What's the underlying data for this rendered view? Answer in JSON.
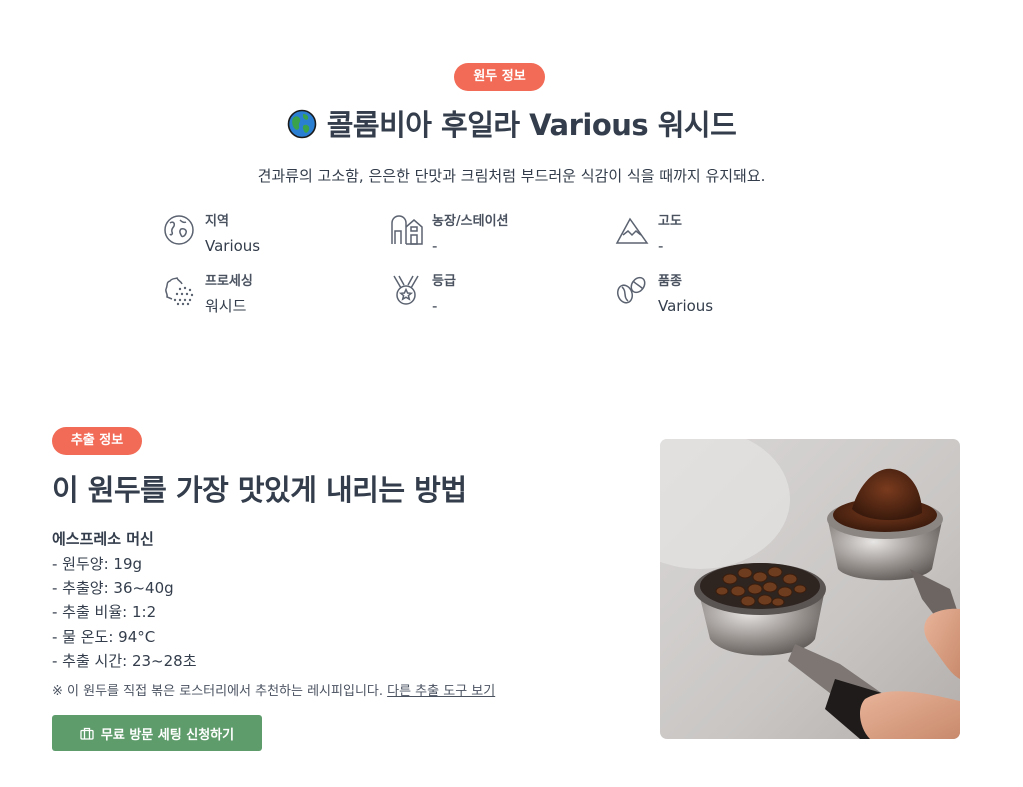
{
  "bean": {
    "badge": "원두 정보",
    "title": "콜롬비아 후일라 Various 워시드",
    "description": "견과류의 고소함, 은은한 단맛과 크림처럼 부드러운 식감이 식을 때까지 유지돼요.",
    "specs": [
      {
        "label": "지역",
        "value": "Various",
        "icon": "globe-icon"
      },
      {
        "label": "농장/스테이션",
        "value": "-",
        "icon": "farm-icon"
      },
      {
        "label": "고도",
        "value": "-",
        "icon": "mountain-icon"
      },
      {
        "label": "프로세싱",
        "value": "워시드",
        "icon": "process-icon"
      },
      {
        "label": "등급",
        "value": "-",
        "icon": "medal-icon"
      },
      {
        "label": "품종",
        "value": "Various",
        "icon": "bean-icon"
      }
    ]
  },
  "brew": {
    "badge": "추출 정보",
    "title": "이 원두를 가장 맛있게 내리는 방법",
    "method": "에스프레소 머신",
    "steps": [
      "- 원두양: 19g",
      "- 추출양: 36~40g",
      "- 추출 비율: 1:2",
      "- 물 온도: 94°C",
      "- 추출 시간: 23~28초"
    ],
    "note": "※ 이 원두를 직접 볶은 로스터리에서 추천하는 레시피입니다. ",
    "note_link": "다른 추출 도구 보기",
    "cta_label": "무료 방문 세팅 신청하기"
  },
  "colors": {
    "accent": "#f26b57",
    "cta": "#5f9c6c",
    "text": "#333d4b"
  }
}
